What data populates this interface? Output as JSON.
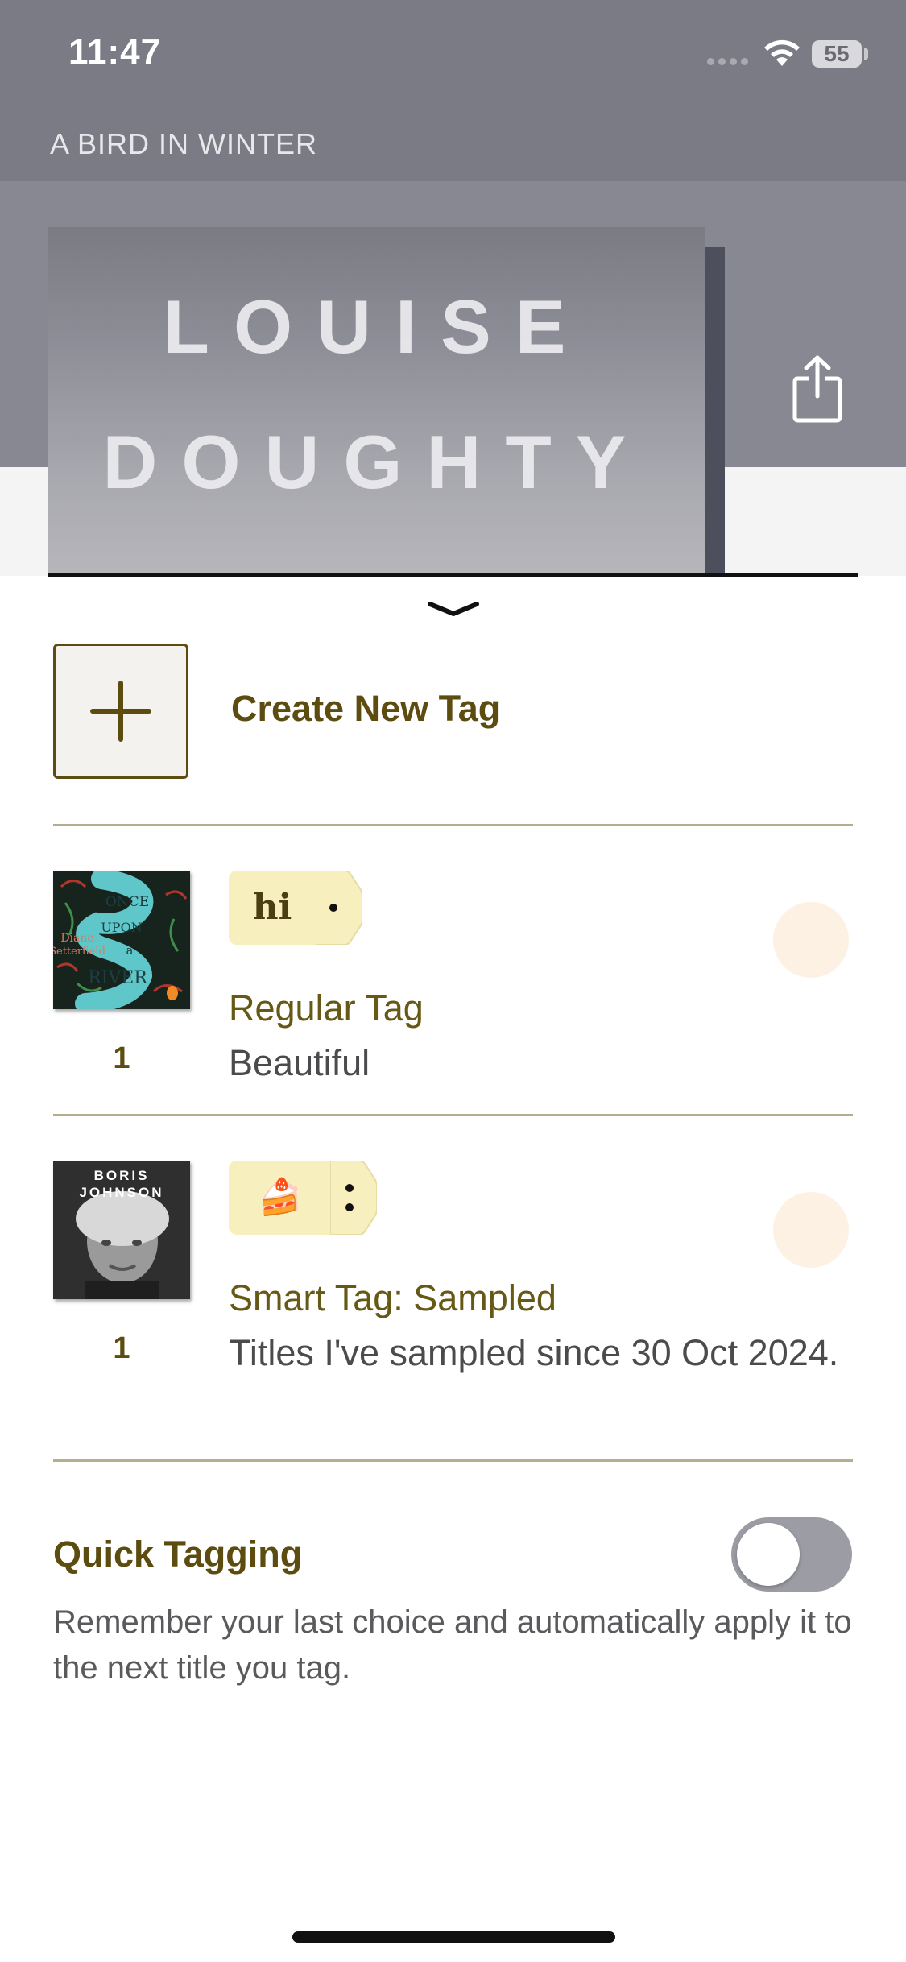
{
  "status_bar": {
    "time": "11:47",
    "battery": "55"
  },
  "header": {
    "book_title": "A BIRD IN WINTER",
    "cover_author_line1": "LOUISE",
    "cover_author_line2": "DOUGHTY",
    "share_icon": "share-icon"
  },
  "sheet": {
    "grabber_icon": "chevron-down-icon",
    "create_tag_label": "Create New Tag",
    "tags": [
      {
        "chip_text": "hi",
        "name": "Regular Tag",
        "description": "Beautiful",
        "count": "1",
        "cover_lines": [
          "ONCE",
          "UPON",
          "a",
          "RIVER"
        ],
        "cover_author": "Diane Setterfield"
      },
      {
        "chip_text": "🍰",
        "name": "Smart Tag: Sampled",
        "description": "Titles I've sampled since 30 Oct 2024.",
        "count": "1",
        "cover_author_line1": "BORIS",
        "cover_author_line2": "JOHNSON"
      }
    ],
    "quick_tagging": {
      "title": "Quick Tagging",
      "description": "Remember your last choice and automatically apply it to the next title you tag.",
      "enabled": false
    }
  },
  "colors": {
    "accent": "#5c4c0f",
    "tag_chip": "#f8efbf",
    "radio": "#fdf1e3",
    "divider": "#b5ae8e"
  }
}
